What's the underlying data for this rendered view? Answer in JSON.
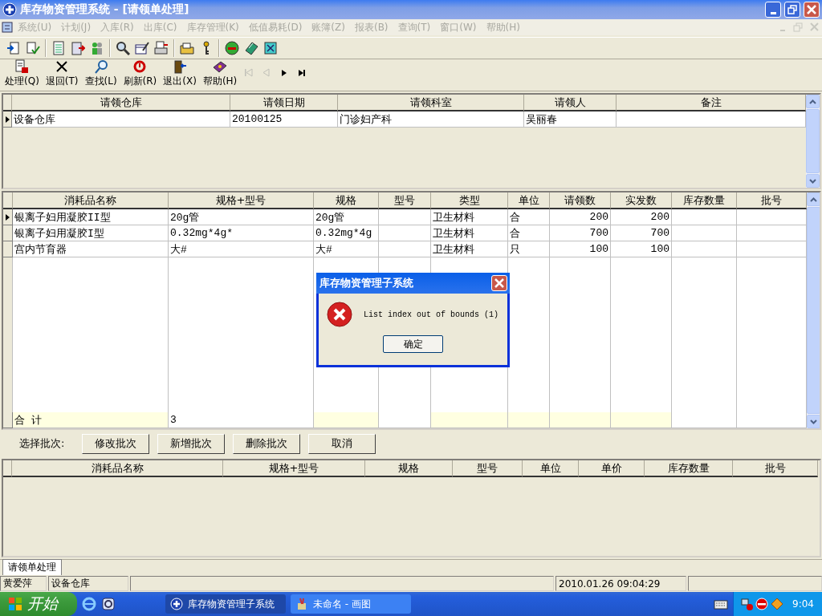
{
  "window": {
    "title": "库存物资管理系统 - [请领单处理]"
  },
  "menu": [
    {
      "label": "系统(U)",
      "disabled": true
    },
    {
      "label": "计划(J)",
      "disabled": true
    },
    {
      "label": "入库(R)",
      "disabled": true
    },
    {
      "label": "出库(C)",
      "disabled": true
    },
    {
      "label": "库存管理(K)",
      "disabled": true
    },
    {
      "label": "低值易耗(D)",
      "disabled": true
    },
    {
      "label": "账簿(Z)",
      "disabled": true
    },
    {
      "label": "报表(B)",
      "disabled": true
    },
    {
      "label": "查询(T)",
      "disabled": true
    },
    {
      "label": "窗口(W)",
      "disabled": true
    },
    {
      "label": "帮助(H)",
      "disabled": true
    }
  ],
  "actions": [
    {
      "label": "处理(Q)",
      "kind": "process"
    },
    {
      "label": "退回(T)",
      "kind": "return"
    },
    {
      "label": "查找(L)",
      "kind": "find"
    },
    {
      "label": "刷新(R)",
      "kind": "refresh"
    },
    {
      "label": "退出(X)",
      "kind": "exit"
    },
    {
      "label": "帮助(H)",
      "kind": "help"
    }
  ],
  "nav_buttons": [
    {
      "kind": "first",
      "disabled": true
    },
    {
      "kind": "prev",
      "disabled": true
    },
    {
      "kind": "next",
      "disabled": false
    },
    {
      "kind": "last",
      "disabled": false
    }
  ],
  "master_grid": {
    "columns": [
      "请领仓库",
      "请领日期",
      "请领科室",
      "请领人",
      "备注"
    ],
    "rows": [
      {
        "selected": true,
        "cells": [
          "设备仓库",
          "20100125",
          "门诊妇产科",
          "吴丽春",
          ""
        ]
      }
    ]
  },
  "detail_grid": {
    "columns": [
      "消耗品名称",
      "规格+型号",
      "规格",
      "型号",
      "类型",
      "单位",
      "请领数",
      "实发数",
      "库存数量",
      "批号"
    ],
    "rows": [
      {
        "selected": true,
        "cells": [
          "银离子妇用凝胶II型",
          "20g管",
          "20g管",
          "",
          "卫生材料",
          "合",
          "200",
          "200",
          "",
          ""
        ]
      },
      {
        "selected": false,
        "cells": [
          "银离子妇用凝胶I型",
          "0.32mg*4g*",
          "0.32mg*4g",
          "",
          "卫生材料",
          "合",
          "700",
          "700",
          "",
          ""
        ]
      },
      {
        "selected": false,
        "cells": [
          "宫内节育器",
          "大#",
          "大#",
          "",
          "卫生材料",
          "只",
          "100",
          "100",
          "",
          ""
        ]
      }
    ],
    "total": {
      "label": "合  计",
      "cells": [
        "",
        "3",
        "",
        "",
        "",
        "",
        "",
        "",
        "",
        ""
      ]
    }
  },
  "batch_bar": {
    "label": "选择批次:",
    "buttons": [
      "修改批次",
      "新增批次",
      "删除批次",
      "取消"
    ]
  },
  "batch_grid": {
    "columns": [
      "消耗品名称",
      "规格+型号",
      "规格",
      "型号",
      "单位",
      "单价",
      "库存数量",
      "批号"
    ]
  },
  "tabs": [
    {
      "label": "请领单处理",
      "selected": true
    }
  ],
  "status_bar": {
    "user": "黄爱萍",
    "warehouse": "设备仓库",
    "datetime": "2010.01.26 09:04:29"
  },
  "dialog": {
    "title": "库存物资管理子系统",
    "message": "List index out of bounds (1)",
    "button": "确定"
  },
  "taskbar": {
    "start": "开始",
    "tasks": [
      {
        "label": "库存物资管理子系统",
        "selected": true,
        "kind": "app"
      },
      {
        "label": "未命名 - 画图",
        "selected": false,
        "kind": "paint"
      }
    ],
    "clock": "9:04"
  }
}
